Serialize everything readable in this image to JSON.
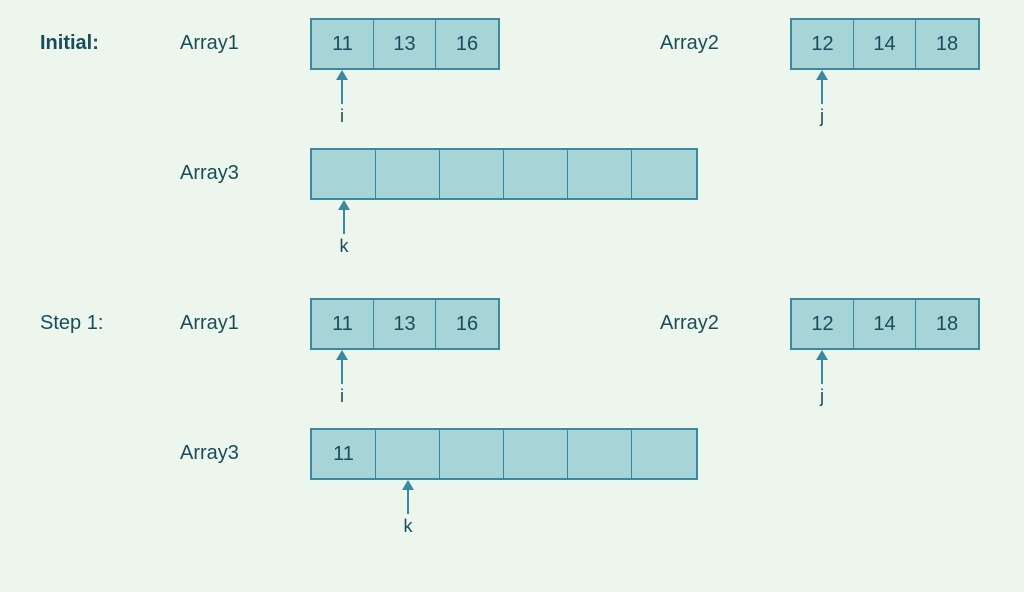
{
  "steps": [
    {
      "label": "Initial:",
      "bold": true,
      "array1": {
        "label": "Array1",
        "values": [
          "11",
          "13",
          "16"
        ],
        "pointer": {
          "name": "i",
          "index": 0
        }
      },
      "array2": {
        "label": "Array2",
        "values": [
          "12",
          "14",
          "18"
        ],
        "pointer": {
          "name": "j",
          "index": 0
        }
      },
      "array3": {
        "label": "Array3",
        "values": [
          "",
          "",
          "",
          "",
          "",
          ""
        ],
        "pointer": {
          "name": "k",
          "index": 0
        }
      }
    },
    {
      "label": "Step 1:",
      "bold": false,
      "array1": {
        "label": "Array1",
        "values": [
          "11",
          "13",
          "16"
        ],
        "pointer": {
          "name": "i",
          "index": 0
        }
      },
      "array2": {
        "label": "Array2",
        "values": [
          "12",
          "14",
          "18"
        ],
        "pointer": {
          "name": "j",
          "index": 0
        }
      },
      "array3": {
        "label": "Array3",
        "values": [
          "11",
          "",
          "",
          "",
          "",
          ""
        ],
        "pointer": {
          "name": "k",
          "index": 1
        }
      }
    }
  ],
  "colors": {
    "bg": "#ecf6ec",
    "cell": "#a7d4d6",
    "border": "#3b89a0",
    "text": "#194d5c"
  }
}
